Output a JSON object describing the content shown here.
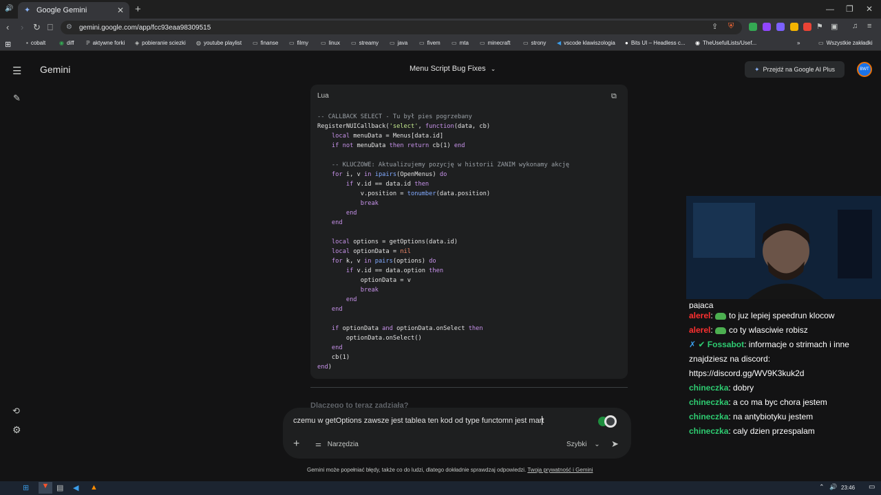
{
  "browser": {
    "tab_title": "Google Gemini",
    "url": "gemini.google.com/app/fcc93eaa98309515",
    "bookmarks": [
      "cobalt",
      "diff",
      "aktywne forki",
      "pobieranie sciezki",
      "youtube playlist",
      "finanse",
      "filmy",
      "linux",
      "streamy",
      "java",
      "fivem",
      "mta",
      "minecraft",
      "strony",
      "vscode klawiszologia",
      "Bits UI – Headless c...",
      "TheUsefulLists/Usef..."
    ],
    "all_bookmarks": "Wszystkie zakładki"
  },
  "app": {
    "title": "Gemini",
    "conversation_title": "Menu Script Bug Fixes",
    "upgrade_label": "Przejdź na Google AI Plus",
    "avatar_text": "BWT"
  },
  "code": {
    "language": "Lua",
    "lines": [
      "-- CALLBACK SELECT - Tu był pies pogrzebany",
      "RegisterNUICallback('select', function(data, cb)",
      "    local menuData = Menus[data.id]",
      "    if not menuData then return cb(1) end",
      "",
      "    -- KLUCZOWE: Aktualizujemy pozycję w historii ZANIM wykonamy akcję",
      "    for i, v in ipairs(OpenMenus) do",
      "        if v.id == data.id then",
      "            v.position = tonumber(data.position)",
      "            break",
      "        end",
      "    end",
      "",
      "    local options = getOptions(data.id)",
      "    local optionData = nil",
      "    for k, v in pairs(options) do",
      "        if v.id == data.option then",
      "            optionData = v",
      "            break",
      "        end",
      "    end",
      "",
      "    if optionData and optionData.onSelect then",
      "        optionData.onSelect()",
      "    end",
      "    cb(1)",
      "end)"
    ]
  },
  "faded_heading": "Dlaczego to teraz zadziała?",
  "composer": {
    "text": "czemu w getOptions zawsze jest tablea ten kod od type functomn jest mart",
    "tools_label": "Narzędzia",
    "mode_label": "Szybki"
  },
  "disclaimer": {
    "text": "Gemini może popełniać błędy, także co do ludzi, dlatego dokładnie sprawdzaj odpowiedzi. ",
    "link": "Twoja prywatność i Gemini"
  },
  "chat": {
    "partial_top": "pajaca",
    "messages": [
      {
        "user": "alerel",
        "text": "to juz lepiej speedrun klocow",
        "color": "#ff3030",
        "emote": true
      },
      {
        "user": "alerel",
        "text": "co ty wlasciwie robisz",
        "color": "#ff3030",
        "emote": true
      },
      {
        "user": "Fossabot",
        "text": "informacje o strimach i inne znajdziesz na discord: https://discord.gg/WV9K3kuk2d",
        "color": "#2ecc71",
        "emote": false
      },
      {
        "user": "chineczka",
        "text": "dobry",
        "color": "#2ecc71",
        "emote": false
      },
      {
        "user": "chineczka",
        "text": "a co ma byc chora jestem",
        "color": "#2ecc71",
        "emote": false
      },
      {
        "user": "chineczka",
        "text": "na antybiotyku jestem",
        "color": "#2ecc71",
        "emote": false
      },
      {
        "user": "chineczka",
        "text": "caly dzien przespalam",
        "color": "#2ecc71",
        "emote": false
      }
    ]
  },
  "taskbar": {
    "time": "23:46"
  }
}
